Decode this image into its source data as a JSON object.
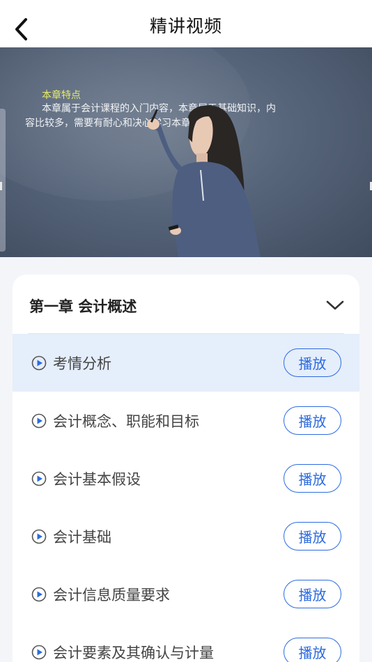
{
  "header": {
    "title": "精讲视频",
    "back_icon": "chevron-left-icon"
  },
  "video": {
    "slide_heading": "本章特点",
    "slide_text": "本章属于会计课程的入门内容，本章属于基础知识，内容比较多，需要有耐心和决心学习本章内容。"
  },
  "chapter": {
    "title": "第一章 会计概述",
    "toggle_icon": "chevron-down-icon",
    "lessons": [
      {
        "title": "考情分析",
        "button": "播放",
        "active": true
      },
      {
        "title": "会计概念、职能和目标",
        "button": "播放",
        "active": false
      },
      {
        "title": "会计基本假设",
        "button": "播放",
        "active": false
      },
      {
        "title": "会计基础",
        "button": "播放",
        "active": false
      },
      {
        "title": "会计信息质量要求",
        "button": "播放",
        "active": false
      },
      {
        "title": "会计要素及其确认与计量",
        "button": "播放",
        "active": false
      }
    ]
  },
  "colors": {
    "accent": "#2d6be0",
    "active_row": "#e5eefb",
    "slide_heading": "#e7ec6a"
  }
}
